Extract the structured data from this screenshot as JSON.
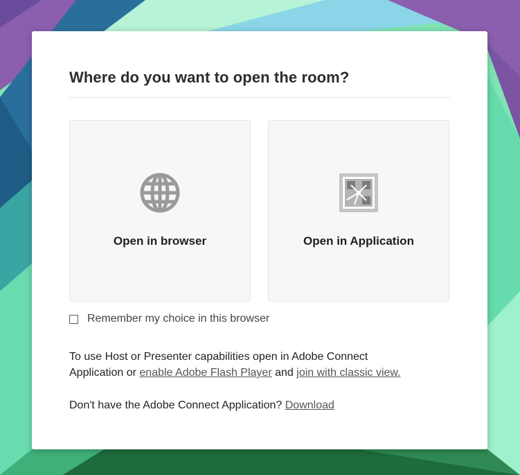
{
  "dialog": {
    "title": "Where do you want to open the room?",
    "options": [
      {
        "label": "Open in browser",
        "icon": "globe-icon"
      },
      {
        "label": "Open in Application",
        "icon": "adobe-connect-app-icon"
      }
    ],
    "remember": {
      "label": "Remember my choice in this browser",
      "checked": false
    },
    "info": {
      "line1": "To use Host or Presenter capabilities open in Adobe Connect",
      "line2_prefix": "Application or",
      "flash_link": "enable Adobe Flash Player",
      "and_text": "and",
      "classic_link": "join with classic view."
    },
    "download": {
      "prompt": "Don't have the Adobe Connect Application?",
      "link": "Download"
    }
  },
  "colors": {
    "icon_gray": "#9a9a9a",
    "card_bg": "#f7f7f7",
    "background_green": "#7fe3b4",
    "background_purple": "#8b5fae",
    "background_blue": "#2a6f9c"
  }
}
